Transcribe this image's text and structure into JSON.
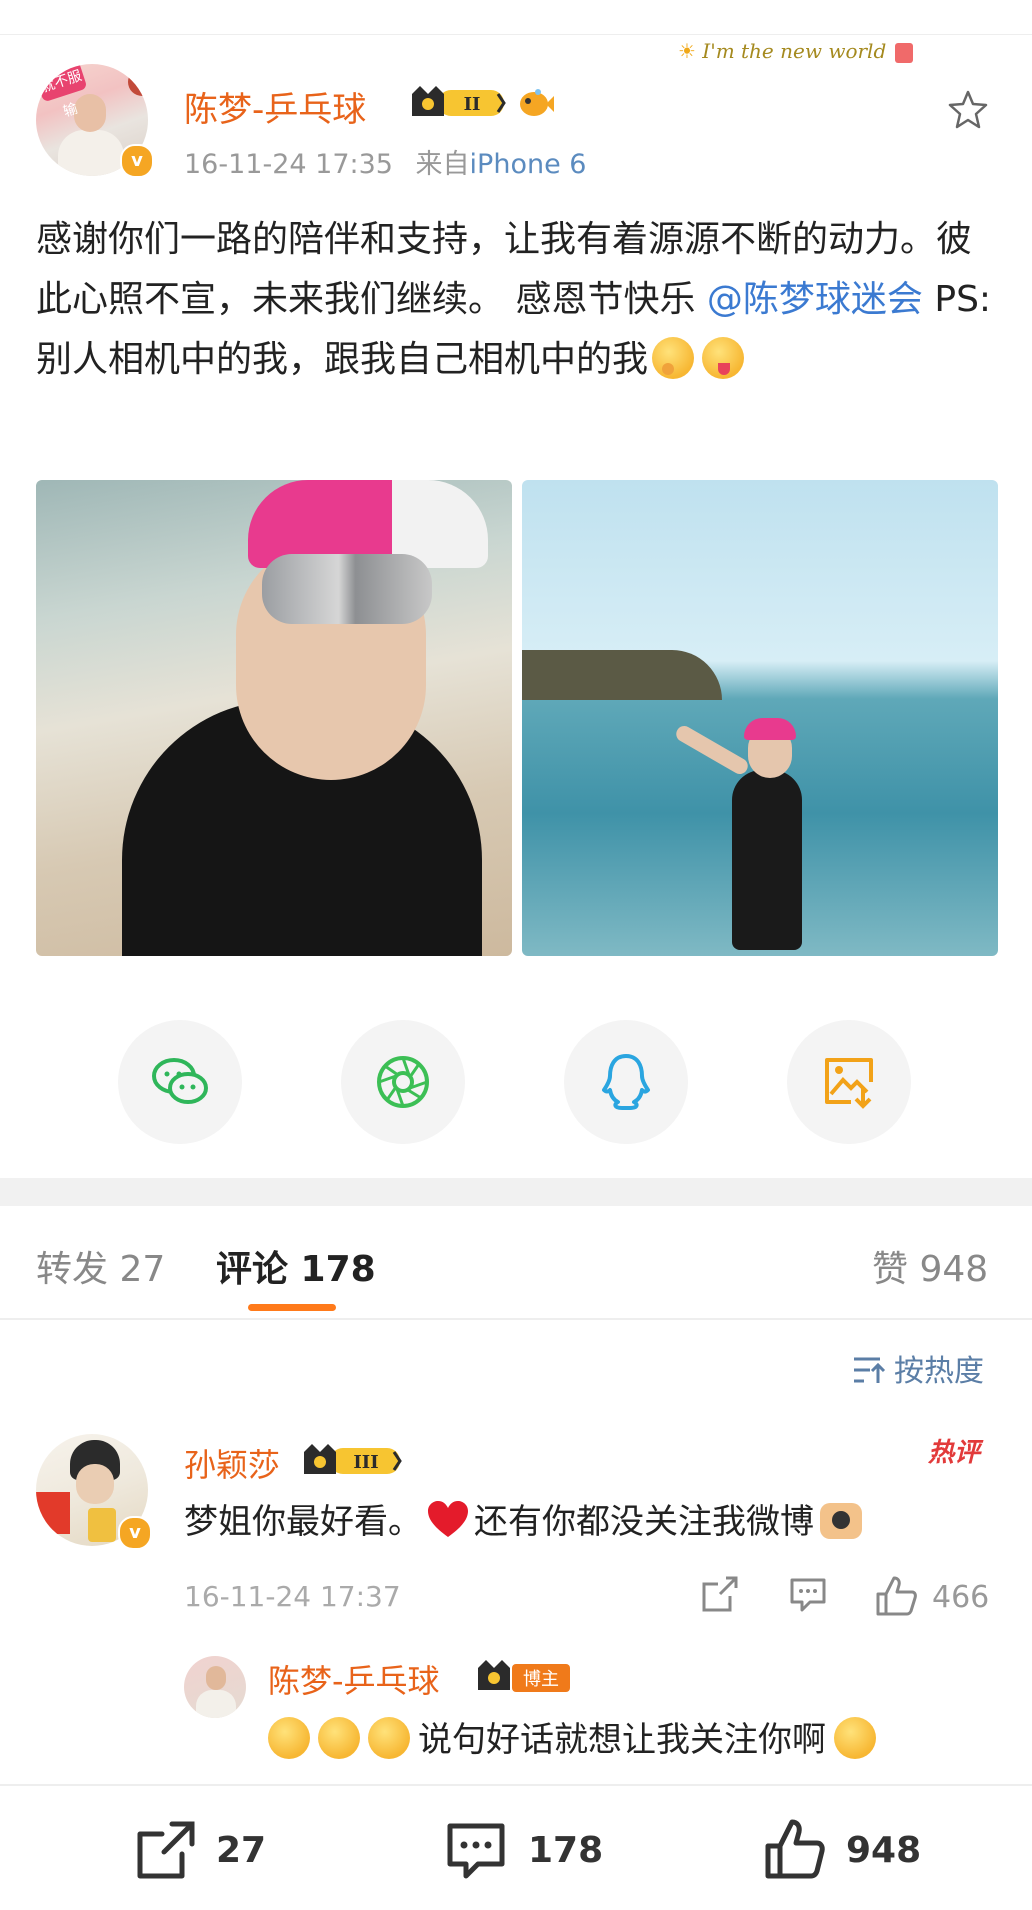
{
  "header_deco": {
    "text": "I'm the new world"
  },
  "post": {
    "author": "陈梦-乒乓球",
    "level_badge": "II",
    "timestamp": "16-11-24 17:35",
    "source_prefix": "来自",
    "source": "iPhone 6",
    "avatar_sticker": "就不服输",
    "text_part1": "感谢你们一路的陪伴和支持，让我有着源源不断的动力。彼此心照不宣，未来我们继续。 感恩节快乐",
    "mention": "@陈梦球迷会",
    "text_part2": " PS:别人相机中的我，跟我自己相机中的我",
    "verified_mark": "v"
  },
  "share_targets": [
    {
      "icon": "wechat-icon",
      "color": "#2fb65a"
    },
    {
      "icon": "moments-icon",
      "color": "#3cbf55"
    },
    {
      "icon": "qq-icon",
      "color": "#2aa5e0"
    },
    {
      "icon": "save-image-icon",
      "color": "#f2a218"
    }
  ],
  "tabs": {
    "repost": "转发 27",
    "comments": "评论 178",
    "likes": "赞 948"
  },
  "sort_label": "按热度",
  "comment": {
    "author": "孙颖莎",
    "level_badge": "III",
    "hot_tag": "热评",
    "text": "梦姐你最好看。",
    "text_after_heart": "还有你都没关注我微博",
    "time": "16-11-24 17:37",
    "likes": "466",
    "verified_mark": "v"
  },
  "reply": {
    "author": "陈梦-乒乓球",
    "badge": "博主",
    "text": "说句好话就想让我关注你啊"
  },
  "bottom_bar": {
    "reposts": "27",
    "comments": "178",
    "likes": "948"
  },
  "colors": {
    "name_orange": "#e8631a",
    "link_blue": "#3b7ad1",
    "tab_underline": "#ff7a1a",
    "hot_red": "#e23a3a"
  }
}
